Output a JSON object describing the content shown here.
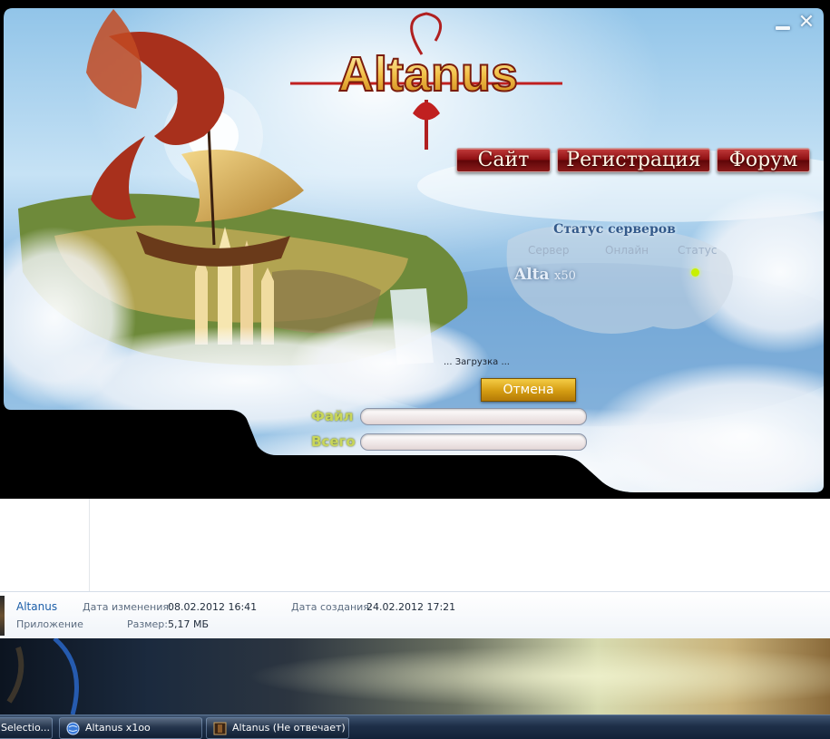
{
  "launcher": {
    "logo_text": "Altanus",
    "nav": {
      "site": "Сайт",
      "registration": "Регистрация",
      "forum": "Форум"
    },
    "window_controls": {
      "minimize_icon": "minimize-icon",
      "close_icon": "close-icon",
      "close_glyph": "✕"
    },
    "server_status": {
      "title": "Статус серверов",
      "columns": [
        "Сервер",
        "Онлайн",
        "Статус"
      ],
      "servers": [
        {
          "name": "Alta",
          "rate": "x50",
          "online": "",
          "status_color": "#c8f000"
        }
      ]
    },
    "loading_text": "... Загрузка ...",
    "cancel_label": "Отмена",
    "progress": {
      "file_label": "Файл",
      "total_label": "Всего",
      "file_fraction": 0,
      "total_fraction": 0
    },
    "colors": {
      "nav_button": "#8e0f12",
      "cancel_button": "#d49c12",
      "label": "#c9d65a"
    }
  },
  "explorer": {
    "file_name": "Altanus",
    "file_type": "Приложение",
    "modified_label": "Дата изменения:",
    "modified_value": "08.02.2012 16:41",
    "created_label": "Дата создания:",
    "created_value": "24.02.2012 17:21",
    "size_label": "Размер:",
    "size_value": "5,17 МБ"
  },
  "taskbar": {
    "items": [
      {
        "label": "Selectio...",
        "icon": ""
      },
      {
        "label": "Altanus x1oo",
        "icon": "globe-icon"
      },
      {
        "label": "Altanus (Не отвечает)",
        "icon": "app-icon"
      }
    ]
  }
}
